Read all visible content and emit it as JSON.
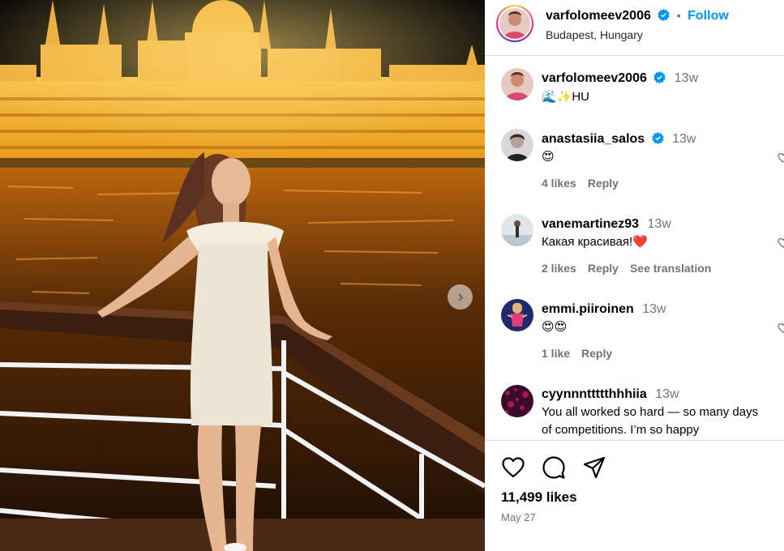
{
  "post": {
    "username": "varfolomeev2006",
    "follow_label": "Follow",
    "location": "Budapest, Hungary",
    "caption_username": "varfolomeev2006",
    "caption_time": "13w",
    "caption_text": "🌊✨HU"
  },
  "comments": [
    {
      "username": "anastasiia_salos",
      "verified": true,
      "time": "13w",
      "text": "😍",
      "likes": "4 likes",
      "reply": "Reply",
      "extra": ""
    },
    {
      "username": "vanemartinez93",
      "verified": false,
      "time": "13w",
      "text": "Какая красивая!❤️",
      "likes": "2 likes",
      "reply": "Reply",
      "extra": "See translation"
    },
    {
      "username": "emmi.piiroinen",
      "verified": false,
      "time": "13w",
      "text": "😍😍",
      "likes": "1 like",
      "reply": "Reply",
      "extra": ""
    },
    {
      "username": "cyynnnttttthhhiia",
      "verified": false,
      "time": "13w",
      "text": "You all worked so hard — so many days of competitions. I’m so happy",
      "likes": "",
      "reply": "",
      "extra": ""
    }
  ],
  "footer": {
    "likes": "11,499 likes",
    "date": "May 27"
  },
  "icons": {
    "like": "heart-icon",
    "comment": "comment-icon",
    "share": "share-icon",
    "next": "chevron-right-icon",
    "verified": "verified-badge-icon"
  },
  "colors": {
    "accent": "#0095f6",
    "verified": "#0095f6",
    "muted": "#737373"
  }
}
